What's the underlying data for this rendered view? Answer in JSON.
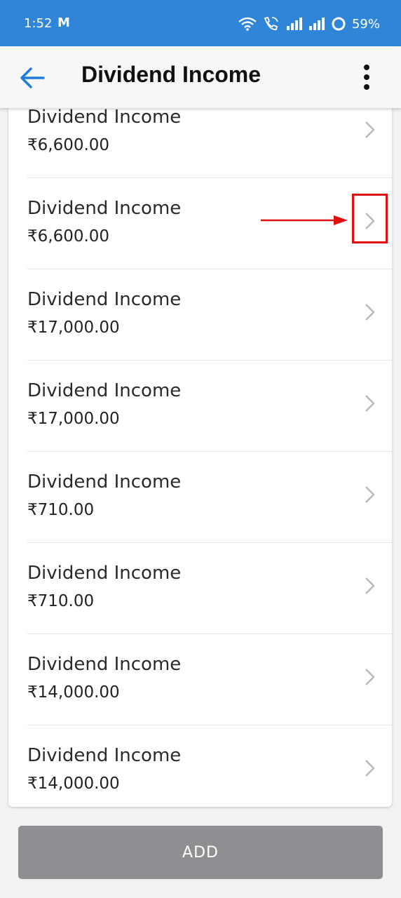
{
  "status": {
    "time": "1:52",
    "battery": "59%"
  },
  "appbar": {
    "title": "Dividend Income"
  },
  "items": [
    {
      "title": "Dividend Income",
      "amount": "₹6,600.00"
    },
    {
      "title": "Dividend Income",
      "amount": "₹6,600.00"
    },
    {
      "title": "Dividend Income",
      "amount": "₹17,000.00"
    },
    {
      "title": "Dividend Income",
      "amount": "₹17,000.00"
    },
    {
      "title": "Dividend Income",
      "amount": "₹710.00"
    },
    {
      "title": "Dividend Income",
      "amount": "₹710.00"
    },
    {
      "title": "Dividend Income",
      "amount": "₹14,000.00"
    },
    {
      "title": "Dividend Income",
      "amount": "₹14,000.00"
    }
  ],
  "footer": {
    "add_label": "ADD"
  },
  "colors": {
    "status_bar": "#2f86d8",
    "back_arrow": "#1e7be0",
    "highlight": "#e01010",
    "add_button": "#8f8f93"
  }
}
